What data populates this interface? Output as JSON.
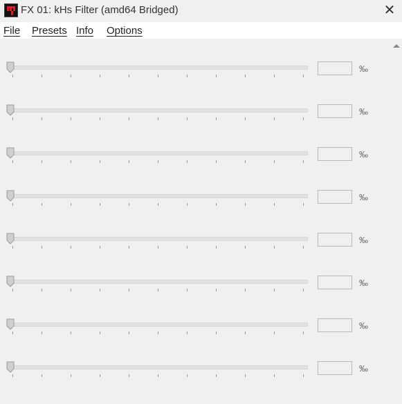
{
  "window": {
    "title": "FX 01: kHs Filter (amd64 Bridged)",
    "close_glyph": "✕",
    "icon": "app-logo-icon"
  },
  "menu": [
    {
      "label": "File"
    },
    {
      "label": "Presets"
    },
    {
      "label": "Info"
    },
    {
      "label": "Options"
    }
  ],
  "params": [
    {
      "value": "",
      "unit": "‰",
      "level": 0
    },
    {
      "value": "",
      "unit": "‰",
      "level": 0
    },
    {
      "value": "",
      "unit": "‰",
      "level": 0
    },
    {
      "value": "",
      "unit": "‰",
      "level": 0
    },
    {
      "value": "",
      "unit": "‰",
      "level": 0
    },
    {
      "value": "",
      "unit": "‰",
      "level": 0
    },
    {
      "value": "",
      "unit": "‰",
      "level": 0
    },
    {
      "value": "",
      "unit": "‰",
      "level": 0
    }
  ],
  "scrollbar": {
    "up_icon": "scroll-up-arrow-icon"
  },
  "colors": {
    "accent": "#d21f2a",
    "background": "#f0f0f0",
    "menubar": "#ffffff"
  }
}
